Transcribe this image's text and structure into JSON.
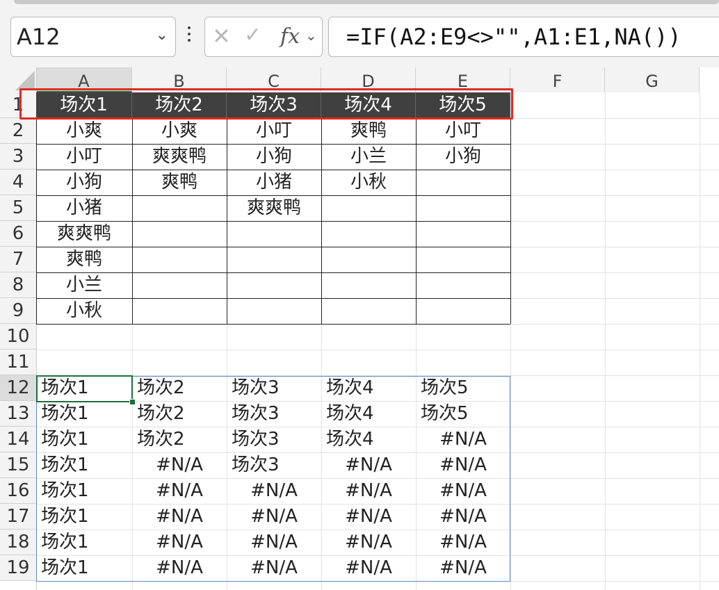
{
  "formula_bar": {
    "name_box": "A12",
    "formula": "=IF(A2:E9<>\"\",A1:E1,NA())",
    "cancel_icon": "close-icon",
    "enter_icon": "check-icon",
    "fx_label": "fx"
  },
  "columns": [
    "A",
    "B",
    "C",
    "D",
    "E",
    "F",
    "G"
  ],
  "rows": [
    "1",
    "2",
    "3",
    "4",
    "5",
    "6",
    "7",
    "8",
    "9",
    "10",
    "11",
    "12",
    "13",
    "14",
    "15",
    "16",
    "17",
    "18",
    "19"
  ],
  "header_row": [
    "场次1",
    "场次2",
    "场次3",
    "场次4",
    "场次5"
  ],
  "data": [
    [
      "小爽",
      "小爽",
      "小叮",
      "爽鸭",
      "小叮"
    ],
    [
      "小叮",
      "爽爽鸭",
      "小狗",
      "小兰",
      "小狗"
    ],
    [
      "小狗",
      "爽鸭",
      "小猪",
      "小秋",
      ""
    ],
    [
      "小猪",
      "",
      "爽爽鸭",
      "",
      ""
    ],
    [
      "爽爽鸭",
      "",
      "",
      "",
      ""
    ],
    [
      "爽鸭",
      "",
      "",
      "",
      ""
    ],
    [
      "小兰",
      "",
      "",
      "",
      ""
    ],
    [
      "小秋",
      "",
      "",
      "",
      ""
    ]
  ],
  "results": [
    [
      "场次1",
      "场次2",
      "场次3",
      "场次4",
      "场次5"
    ],
    [
      "场次1",
      "场次2",
      "场次3",
      "场次4",
      "场次5"
    ],
    [
      "场次1",
      "场次2",
      "场次3",
      "场次4",
      "#N/A"
    ],
    [
      "场次1",
      "#N/A",
      "场次3",
      "#N/A",
      "#N/A"
    ],
    [
      "场次1",
      "#N/A",
      "#N/A",
      "#N/A",
      "#N/A"
    ],
    [
      "场次1",
      "#N/A",
      "#N/A",
      "#N/A",
      "#N/A"
    ],
    [
      "场次1",
      "#N/A",
      "#N/A",
      "#N/A",
      "#N/A"
    ],
    [
      "场次1",
      "#N/A",
      "#N/A",
      "#N/A",
      "#N/A"
    ]
  ],
  "colors": {
    "header_fill": "#404040",
    "highlight_border": "#e02a1f",
    "selection": "#1e6e3b",
    "spill_border": "#5a8ac6"
  }
}
